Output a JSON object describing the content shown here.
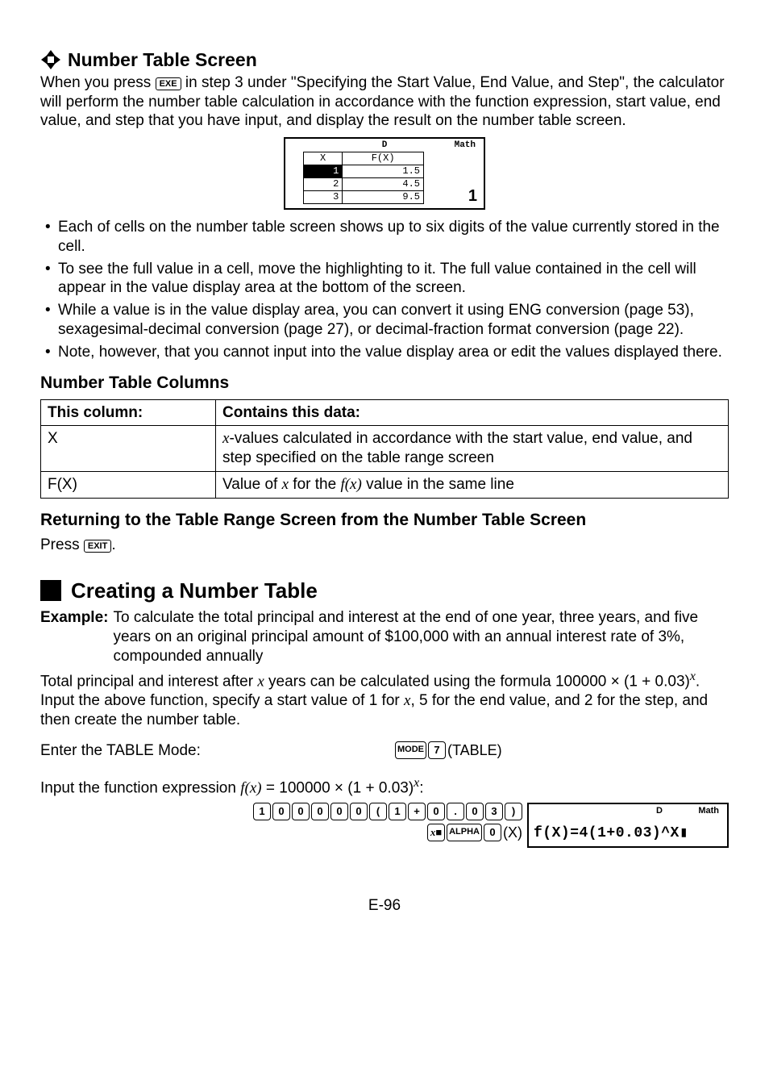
{
  "section1": {
    "heading": "Number Table Screen",
    "intro_a": "When you press ",
    "intro_key": "EXE",
    "intro_b": " in step 3 under \"Specifying the Start Value, End Value, and Step\", the calculator will perform the number table calculation in accordance with the function expression, start value, end value, and step that you have input, and display the result on the number table screen.",
    "screen": {
      "status_d": "D",
      "status_math": "Math",
      "hdr_x": "X",
      "hdr_fx": "F(X)",
      "rows": [
        {
          "x": "1",
          "fx": "1.5"
        },
        {
          "x": "2",
          "fx": "4.5"
        },
        {
          "x": "3",
          "fx": "9.5"
        }
      ],
      "value": "1"
    },
    "bullets": [
      "Each of cells on the number table screen shows up to six digits of the value currently stored in the cell.",
      "To see the full value in a cell, move the highlighting to it. The full value contained in the cell will appear in the value display area at the bottom of the screen.",
      "While a value is in the value display area, you can convert it using ENG conversion (page 53), sexagesimal-decimal conversion (page 27), or decimal-fraction format conversion (page 22).",
      "Note, however, that you cannot input into the value display area or edit the values displayed there."
    ]
  },
  "columns": {
    "heading": "Number Table Columns",
    "th1": "This column:",
    "th2": "Contains this data:",
    "r1c1": "X",
    "r1c2_a": "x",
    "r1c2_b": "-values calculated in accordance with the start value, end value, and step specified on the table range screen",
    "r2c1": "F(X)",
    "r2c2_a": "Value of ",
    "r2c2_x1": "x",
    "r2c2_b": " for the ",
    "r2c2_fx": "f(x)",
    "r2c2_c": " value in the same line"
  },
  "returning": {
    "heading": "Returning to the Table Range Screen from the Number Table Screen",
    "body_a": "Press ",
    "key": "EXIT",
    "body_b": "."
  },
  "creating": {
    "heading": "Creating a Number Table",
    "example_label": "Example:",
    "example_body": "To calculate the total principal and interest at the end of one year, three years, and five years on an original principal amount of $100,000 with an annual interest rate of 3%, compounded annually",
    "formula_a": "Total principal and interest after ",
    "formula_x": "x",
    "formula_b": " years can be calculated using the formula 100000 × (1 + 0.03)",
    "formula_sup": "x",
    "formula_c": ". Input the above function, specify a start value of 1 for ",
    "formula_x2": "x",
    "formula_d": ", 5 for the end value, and 2 for the step, and then create the number table.",
    "step1_label": "Enter the TABLE Mode:",
    "step1_keys": {
      "mode": "MODE",
      "seven": "7",
      "label": "(TABLE)"
    },
    "step2_a": "Input the function expression ",
    "step2_fx": "f(x)",
    "step2_b": " = 100000 × (1 + 0.03)",
    "step2_sup": "x",
    "step2_c": ":",
    "keyseq": [
      "1",
      "0",
      "0",
      "0",
      "0",
      "0",
      "(",
      "1",
      "+",
      "0",
      ".",
      "0",
      "3",
      ")"
    ],
    "keyseq2_xn": "x■",
    "keyseq2_alpha": "ALPHA",
    "keyseq2_zero": "0",
    "keyseq2_label": "(X)",
    "screen2": {
      "status_d": "D",
      "status_math": "Math",
      "expr": "f(X)=4(1+0.03)^X▮"
    }
  },
  "footer": "E-96"
}
